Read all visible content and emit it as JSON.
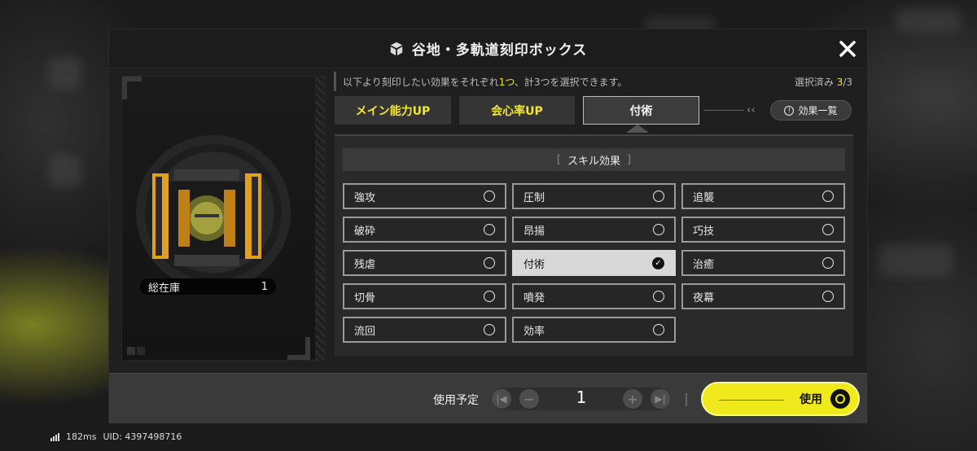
{
  "dialog": {
    "title": "谷地・多軌道刻印ボックス",
    "instruction_prefix": "以下より刻印したい効果をそれぞれ",
    "instruction_highlight": "1つ",
    "instruction_suffix": "、計3つを選択できます。",
    "selected_label": "選択済み",
    "selected_count": "3",
    "selected_total": "/3"
  },
  "inventory": {
    "stock_label": "総在庫",
    "stock_value": "1"
  },
  "tabs": [
    {
      "label": "メイン能力UP",
      "active": false
    },
    {
      "label": "会心率UP",
      "active": false
    },
    {
      "label": "付術",
      "active": true
    }
  ],
  "effects_list_button": "効果一覧",
  "section": {
    "bracket_left": "[",
    "title": "スキル効果",
    "bracket_right": "]"
  },
  "options": [
    {
      "label": "強攻",
      "selected": false
    },
    {
      "label": "圧制",
      "selected": false
    },
    {
      "label": "追襲",
      "selected": false
    },
    {
      "label": "破砕",
      "selected": false
    },
    {
      "label": "昂揚",
      "selected": false
    },
    {
      "label": "巧技",
      "selected": false
    },
    {
      "label": "残虐",
      "selected": false
    },
    {
      "label": "付術",
      "selected": true
    },
    {
      "label": "治癒",
      "selected": false
    },
    {
      "label": "切骨",
      "selected": false
    },
    {
      "label": "噴発",
      "selected": false
    },
    {
      "label": "夜幕",
      "selected": false
    },
    {
      "label": "流回",
      "selected": false
    },
    {
      "label": "効率",
      "selected": false
    }
  ],
  "quantity": {
    "label": "使用予定",
    "value": "1"
  },
  "use_button": "使用",
  "footer": {
    "ping": "182ms",
    "uid": "UID: 4397498716"
  },
  "colors": {
    "accent_yellow": "#f2e53a",
    "button_yellow": "#f0ea1c",
    "panel_dark": "#1f1f1f"
  }
}
